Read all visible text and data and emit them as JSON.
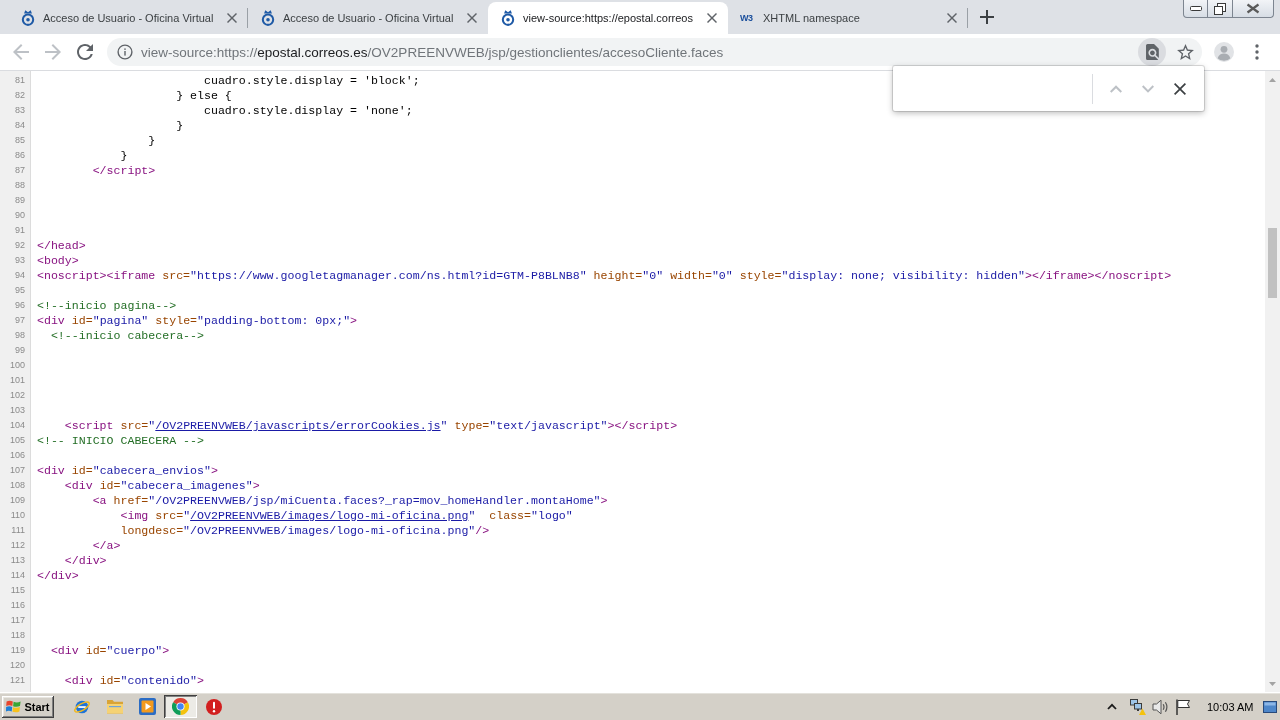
{
  "tabs": [
    {
      "title": "Acceso de Usuario - Oficina Virtual",
      "kind": "emblem",
      "selected": false
    },
    {
      "title": "Acceso de Usuario - Oficina Virtual",
      "kind": "emblem",
      "selected": false
    },
    {
      "title": "view-source:https://epostal.correos",
      "kind": "emblem",
      "selected": true
    },
    {
      "title": "XHTML namespace",
      "kind": "logo",
      "logo_text": "W3",
      "selected": false
    }
  ],
  "toolbar": {
    "nav_buttons": [
      {
        "kind": "back",
        "disabled": true
      },
      {
        "kind": "forward",
        "disabled": true
      },
      {
        "kind": "reload",
        "disabled": false
      }
    ],
    "address": {
      "scheme": "view-source:https://",
      "host": "epostal.correos.es",
      "path": "/OV2PREENVWEB/jsp/gestionclientes/accesoCliente.faces"
    },
    "page_actions": [
      {
        "kind": "find",
        "active": true
      },
      {
        "kind": "bookmark",
        "active": false
      }
    ]
  },
  "find_bar": {
    "open": true,
    "buttons": [
      {
        "kind": "previous",
        "disabled": true
      },
      {
        "kind": "next",
        "disabled": true
      },
      {
        "kind": "close",
        "disabled": false
      }
    ]
  },
  "source": {
    "lines": [
      {
        "number": "81",
        "tokens": [
          {
            "kind": "text",
            "text": "                        cuadro.style.display = 'block';"
          }
        ]
      },
      {
        "number": "82",
        "tokens": [
          {
            "kind": "text",
            "text": "                    } else {"
          }
        ]
      },
      {
        "number": "83",
        "tokens": [
          {
            "kind": "text",
            "text": "                        cuadro.style.display = 'none';"
          }
        ]
      },
      {
        "number": "84",
        "tokens": [
          {
            "kind": "text",
            "text": "                    }"
          }
        ]
      },
      {
        "number": "85",
        "tokens": [
          {
            "kind": "text",
            "text": "                }"
          }
        ]
      },
      {
        "number": "86",
        "tokens": [
          {
            "kind": "text",
            "text": "            }"
          }
        ]
      },
      {
        "number": "87",
        "tokens": [
          {
            "kind": "tag",
            "text": "        </script>"
          }
        ]
      },
      {
        "number": "88"
      },
      {
        "number": "89"
      },
      {
        "number": "90"
      },
      {
        "number": "91"
      },
      {
        "number": "92",
        "tokens": [
          {
            "kind": "tag",
            "text": "</head>"
          }
        ]
      },
      {
        "number": "93",
        "tokens": [
          {
            "kind": "tag",
            "text": "<body>"
          }
        ]
      },
      {
        "number": "94",
        "tokens": [
          {
            "kind": "tag",
            "text": "<noscript><iframe "
          },
          {
            "kind": "attr",
            "text": "src="
          },
          {
            "kind": "value",
            "text": "\"https://www.googletagmanager.com/ns.html?id=GTM-P8BLNB8\""
          },
          {
            "kind": "attr",
            "text": " height="
          },
          {
            "kind": "value",
            "text": "\"0\""
          },
          {
            "kind": "attr",
            "text": " width="
          },
          {
            "kind": "value",
            "text": "\"0\""
          },
          {
            "kind": "attr",
            "text": " style="
          },
          {
            "kind": "value",
            "text": "\"display: none; visibility: hidden\""
          },
          {
            "kind": "tag",
            "text": "></iframe></noscript>"
          }
        ]
      },
      {
        "number": "95"
      },
      {
        "number": "96",
        "tokens": [
          {
            "kind": "comment",
            "text": "<!--inicio pagina-->"
          }
        ]
      },
      {
        "number": "97",
        "tokens": [
          {
            "kind": "tag",
            "text": "<div "
          },
          {
            "kind": "attr",
            "text": "id="
          },
          {
            "kind": "value",
            "text": "\"pagina\""
          },
          {
            "kind": "attr",
            "text": " style="
          },
          {
            "kind": "value",
            "text": "\"padding-bottom: 0px;\""
          },
          {
            "kind": "tag",
            "text": ">"
          }
        ]
      },
      {
        "number": "98",
        "tokens": [
          {
            "kind": "comment",
            "text": "  <!--inicio cabecera-->"
          }
        ]
      },
      {
        "number": "99"
      },
      {
        "number": "100"
      },
      {
        "number": "101"
      },
      {
        "number": "102"
      },
      {
        "number": "103"
      },
      {
        "number": "104",
        "tokens": [
          {
            "kind": "tag",
            "text": "    <script "
          },
          {
            "kind": "attr",
            "text": "src="
          },
          {
            "kind": "value",
            "text": "\""
          },
          {
            "kind": "link",
            "text": "/OV2PREENVWEB/javascripts/errorCookies.js"
          },
          {
            "kind": "value",
            "text": "\""
          },
          {
            "kind": "attr",
            "text": " type="
          },
          {
            "kind": "value",
            "text": "\"text/javascript\""
          },
          {
            "kind": "tag",
            "text": "></script>"
          }
        ]
      },
      {
        "number": "105",
        "tokens": [
          {
            "kind": "comment",
            "text": "<!-- INICIO CABECERA -->"
          }
        ]
      },
      {
        "number": "106"
      },
      {
        "number": "107",
        "tokens": [
          {
            "kind": "tag",
            "text": "<div "
          },
          {
            "kind": "attr",
            "text": "id="
          },
          {
            "kind": "value",
            "text": "\"cabecera_envios\""
          },
          {
            "kind": "tag",
            "text": ">"
          }
        ]
      },
      {
        "number": "108",
        "tokens": [
          {
            "kind": "tag",
            "text": "    <div "
          },
          {
            "kind": "attr",
            "text": "id="
          },
          {
            "kind": "value",
            "text": "\"cabecera_imagenes\""
          },
          {
            "kind": "tag",
            "text": ">"
          }
        ]
      },
      {
        "number": "109",
        "tokens": [
          {
            "kind": "tag",
            "text": "        <a "
          },
          {
            "kind": "attr",
            "text": "href="
          },
          {
            "kind": "value",
            "text": "\"/OV2PREENVWEB/jsp/miCuenta.faces?_rap=mov_homeHandler.montaHome\""
          },
          {
            "kind": "tag",
            "text": ">"
          }
        ]
      },
      {
        "number": "110",
        "tokens": [
          {
            "kind": "tag",
            "text": "            <img "
          },
          {
            "kind": "attr",
            "text": "src="
          },
          {
            "kind": "value",
            "text": "\""
          },
          {
            "kind": "link",
            "text": "/OV2PREENVWEB/images/logo-mi-oficina.png"
          },
          {
            "kind": "value",
            "text": "\""
          },
          {
            "kind": "attr",
            "text": "  class="
          },
          {
            "kind": "value",
            "text": "\"logo\""
          }
        ]
      },
      {
        "number": "111",
        "tokens": [
          {
            "kind": "attr",
            "text": "            longdesc="
          },
          {
            "kind": "value",
            "text": "\"/OV2PREENVWEB/images/logo-mi-oficina.png\""
          },
          {
            "kind": "tag",
            "text": "/>"
          }
        ]
      },
      {
        "number": "112",
        "tokens": [
          {
            "kind": "tag",
            "text": "        </a>"
          }
        ]
      },
      {
        "number": "113",
        "tokens": [
          {
            "kind": "tag",
            "text": "    </div>"
          }
        ]
      },
      {
        "number": "114",
        "tokens": [
          {
            "kind": "tag",
            "text": "</div>"
          }
        ]
      },
      {
        "number": "115"
      },
      {
        "number": "116"
      },
      {
        "number": "117"
      },
      {
        "number": "118"
      },
      {
        "number": "119",
        "tokens": [
          {
            "kind": "tag",
            "text": "  <div "
          },
          {
            "kind": "attr",
            "text": "id="
          },
          {
            "kind": "value",
            "text": "\"cuerpo\""
          },
          {
            "kind": "tag",
            "text": ">"
          }
        ]
      },
      {
        "number": "120"
      },
      {
        "number": "121",
        "tokens": [
          {
            "kind": "tag",
            "text": "    <div "
          },
          {
            "kind": "attr",
            "text": "id="
          },
          {
            "kind": "value",
            "text": "\"contenido\""
          },
          {
            "kind": "tag",
            "text": ">"
          }
        ]
      }
    ]
  },
  "taskbar": {
    "start_label": "Start",
    "apps": [
      {
        "kind": "globe",
        "active": false
      },
      {
        "kind": "folder",
        "active": false
      },
      {
        "kind": "media",
        "active": false
      },
      {
        "kind": "wheel",
        "active": true
      },
      {
        "kind": "alert",
        "active": false
      }
    ],
    "clock": "10:03 AM"
  }
}
